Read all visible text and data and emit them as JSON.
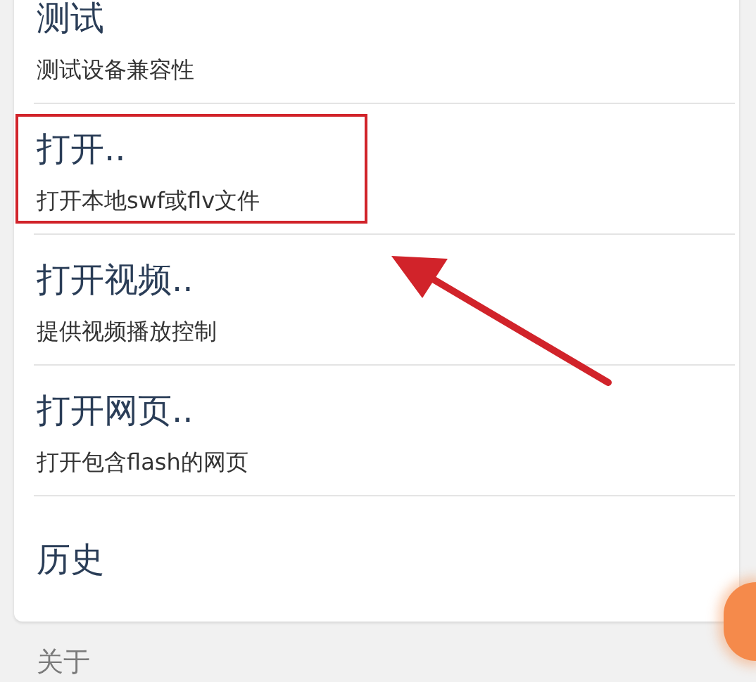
{
  "menu_items": [
    {
      "title": "测试",
      "subtitle": "测试设备兼容性",
      "highlighted": false
    },
    {
      "title": "打开..",
      "subtitle": "打开本地swf或flv文件",
      "highlighted": true
    },
    {
      "title": "打开视频..",
      "subtitle": "提供视频播放控制",
      "highlighted": false
    },
    {
      "title": "打开网页..",
      "subtitle": "打开包含flash的网页",
      "highlighted": false
    },
    {
      "title": "历史",
      "highlighted": false
    }
  ],
  "section_header": "关于"
}
